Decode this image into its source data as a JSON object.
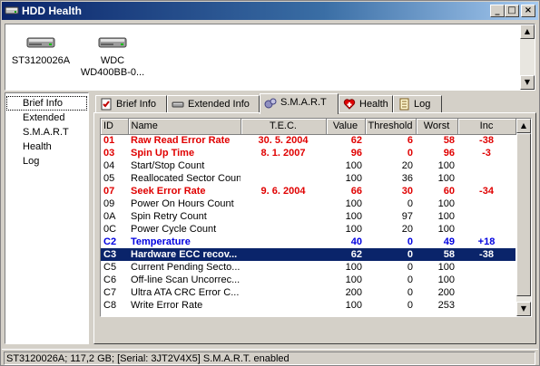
{
  "window": {
    "title": "HDD Health",
    "controls": {
      "minimize": "_",
      "maximize": "□",
      "close": "×"
    }
  },
  "drives": [
    {
      "label_line1": "ST3120026A",
      "label_line2": "",
      "icon": "hdd-icon"
    },
    {
      "label_line1": "WDC",
      "label_line2": "WD400BB-0...",
      "icon": "hdd-icon"
    }
  ],
  "sidebar": {
    "items": [
      {
        "label": "Brief Info"
      },
      {
        "label": "Extended"
      },
      {
        "label": "S.M.A.R.T"
      },
      {
        "label": "Health"
      },
      {
        "label": "Log"
      }
    ]
  },
  "tabs": [
    {
      "label": "Brief Info",
      "icon": "checklist-icon"
    },
    {
      "label": "Extended Info",
      "icon": "drive-icon"
    },
    {
      "label": "S.M.A.R.T",
      "icon": "smart-icon",
      "active": true
    },
    {
      "label": "Health",
      "icon": "health-icon"
    },
    {
      "label": "Log",
      "icon": "log-icon"
    }
  ],
  "smart_table": {
    "columns": [
      "ID",
      "Name",
      "T.E.C.",
      "Value",
      "Threshold",
      "Worst",
      "Inc"
    ],
    "rows": [
      {
        "id": "01",
        "name": "Raw Read Error Rate",
        "tec": "30. 5. 2004",
        "value": "62",
        "threshold": "6",
        "worst": "58",
        "inc": "-38",
        "style": "red"
      },
      {
        "id": "03",
        "name": "Spin Up Time",
        "tec": "8. 1. 2007",
        "value": "96",
        "threshold": "0",
        "worst": "96",
        "inc": "-3",
        "style": "red"
      },
      {
        "id": "04",
        "name": "Start/Stop Count",
        "tec": "",
        "value": "100",
        "threshold": "20",
        "worst": "100",
        "inc": "",
        "style": "normal"
      },
      {
        "id": "05",
        "name": "Reallocated Sector Count",
        "tec": "",
        "value": "100",
        "threshold": "36",
        "worst": "100",
        "inc": "",
        "style": "normal"
      },
      {
        "id": "07",
        "name": "Seek Error Rate",
        "tec": "9. 6. 2004",
        "value": "66",
        "threshold": "30",
        "worst": "60",
        "inc": "-34",
        "style": "red"
      },
      {
        "id": "09",
        "name": "Power On Hours Count",
        "tec": "",
        "value": "100",
        "threshold": "0",
        "worst": "100",
        "inc": "",
        "style": "normal"
      },
      {
        "id": "0A",
        "name": "Spin Retry Count",
        "tec": "",
        "value": "100",
        "threshold": "97",
        "worst": "100",
        "inc": "",
        "style": "normal"
      },
      {
        "id": "0C",
        "name": "Power Cycle Count",
        "tec": "",
        "value": "100",
        "threshold": "20",
        "worst": "100",
        "inc": "",
        "style": "normal"
      },
      {
        "id": "C2",
        "name": "Temperature",
        "tec": "",
        "value": "40",
        "threshold": "0",
        "worst": "49",
        "inc": "+18",
        "style": "blue"
      },
      {
        "id": "C3",
        "name": "Hardware ECC recov...",
        "tec": "",
        "value": "62",
        "threshold": "0",
        "worst": "58",
        "inc": "-38",
        "style": "selected"
      },
      {
        "id": "C5",
        "name": "Current Pending Secto...",
        "tec": "",
        "value": "100",
        "threshold": "0",
        "worst": "100",
        "inc": "",
        "style": "normal"
      },
      {
        "id": "C6",
        "name": "Off-line Scan Uncorrec...",
        "tec": "",
        "value": "100",
        "threshold": "0",
        "worst": "100",
        "inc": "",
        "style": "normal"
      },
      {
        "id": "C7",
        "name": "Ultra ATA CRC Error C...",
        "tec": "",
        "value": "200",
        "threshold": "0",
        "worst": "200",
        "inc": "",
        "style": "normal"
      },
      {
        "id": "C8",
        "name": "Write Error Rate",
        "tec": "",
        "value": "100",
        "threshold": "0",
        "worst": "253",
        "inc": "",
        "style": "normal"
      }
    ]
  },
  "statusbar": {
    "text": "ST3120026A;  117,2 GB;  [Serial: 3JT2V4X5]   S.M.A.R.T. enabled"
  },
  "colors": {
    "titlebar": "#0a246a",
    "warning_text": "#e00000",
    "temperature_text": "#0000e0",
    "selection": "#0a246a",
    "face": "#d4d0c8"
  }
}
